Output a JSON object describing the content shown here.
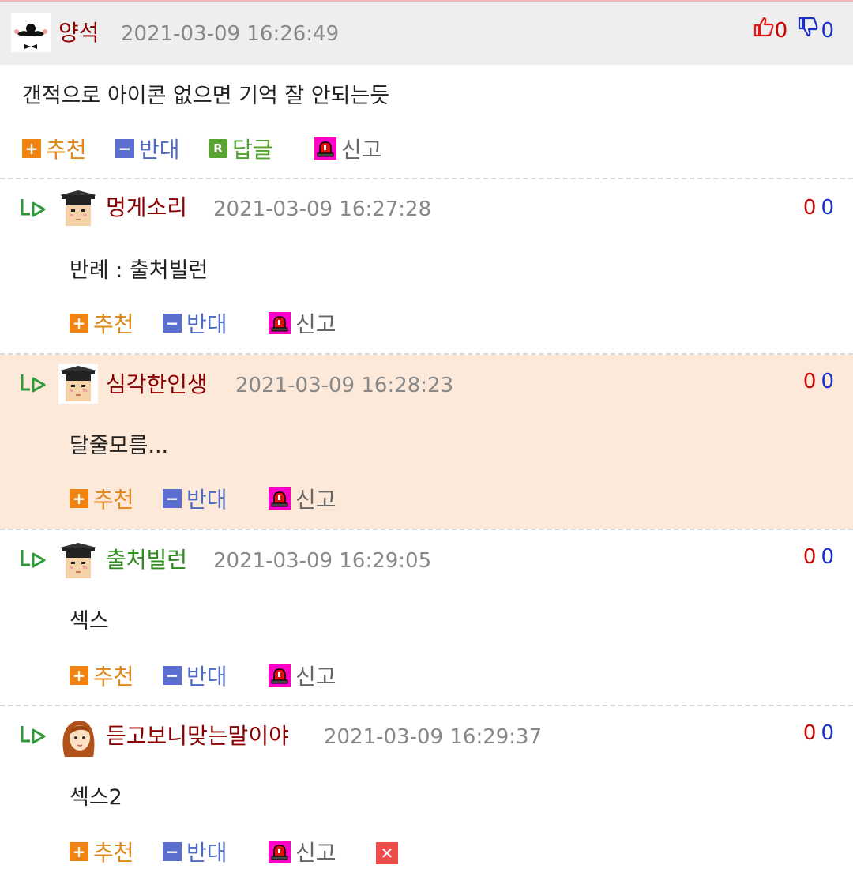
{
  "colors": {
    "nick": "#8b0000",
    "nick_alt": "#2e8b1e",
    "date": "#888888",
    "recommend": "#e0871a",
    "oppose": "#4e6bc4",
    "reply": "#52a22e",
    "report_icon": "#ff00c8",
    "highlight_bg": "#fde9d9",
    "vote_up": "#d00000",
    "vote_down": "#1a2fc8"
  },
  "actions": {
    "recommend": "추천",
    "oppose": "반대",
    "reply": "답글",
    "report": "신고"
  },
  "comments": [
    {
      "nick": "양석",
      "date": "2021-03-09 16:26:49",
      "text": "갠적으로 아이콘 없으면 기억 잘 안되는듯",
      "up": "0",
      "down": "0",
      "avatar_icon": "mustache-avatar-icon"
    },
    {
      "nick": "멍게소리",
      "date": "2021-03-09 16:27:28",
      "text": "반례 : 출처빌런",
      "up": "0",
      "down": "0",
      "avatar_icon": "graduate-avatar-icon"
    },
    {
      "nick": "심각한인생",
      "date": "2021-03-09 16:28:23",
      "text": "달줄모름...",
      "up": "0",
      "down": "0",
      "avatar_icon": "graduate-avatar-icon"
    },
    {
      "nick": "출처빌런",
      "date": "2021-03-09 16:29:05",
      "text": "섹스",
      "up": "0",
      "down": "0",
      "avatar_icon": "graduate-avatar-icon"
    },
    {
      "nick": "듣고보니맞는말이야",
      "date": "2021-03-09 16:29:37",
      "text": "섹스2",
      "up": "0",
      "down": "0",
      "avatar_icon": "girl-avatar-icon"
    }
  ]
}
